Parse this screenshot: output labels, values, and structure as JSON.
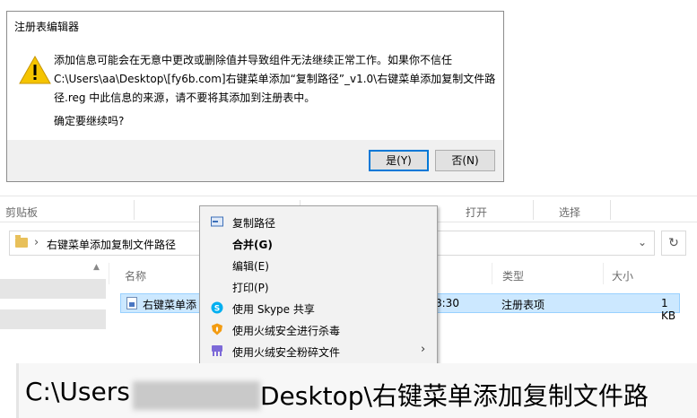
{
  "dialog": {
    "title": "注册表编辑器",
    "message": "添加信息可能会在无意中更改或删除值并导致组件无法继续正常工作。如果你不信任 C:\\Users\\aa\\Desktop\\[fy6b.com]右键菜单添加“复制路径”_v1.0\\右键菜单添加复制文件路径.reg 中此信息的来源，请不要将其添加到注册表中。",
    "confirm": "确定要继续吗?",
    "yes_label": "是(Y)",
    "no_label": "否(N)",
    "icon": "warning-icon"
  },
  "explorer": {
    "ribbon": {
      "clipboard": "剪贴板",
      "open": "打开",
      "select": "选择"
    },
    "address": {
      "separator": "›",
      "path": "右键菜单添加复制文件路径",
      "dropdown": "⌄",
      "refresh": "↻"
    },
    "columns": {
      "name": "名称",
      "type": "类型",
      "size": "大小"
    },
    "file": {
      "name": "右键菜单添",
      "time": "8:30",
      "type": "注册表项",
      "size": "1 KB"
    }
  },
  "context_menu": {
    "items": [
      {
        "label": "复制路径",
        "icon": "copy-path-icon"
      },
      {
        "label": "合并(G)",
        "bold": true
      },
      {
        "label": "编辑(E)"
      },
      {
        "label": "打印(P)"
      },
      {
        "label": "使用 Skype 共享",
        "icon": "skype-icon"
      },
      {
        "label": "使用火绒安全进行杀毒",
        "icon": "huorong-shield-icon"
      },
      {
        "label": "使用火绒安全粉碎文件",
        "icon": "huorong-shred-icon",
        "submenu": "›"
      }
    ]
  },
  "zoom_path": {
    "part1": "C:\\Users",
    "part2": "Desktop\\右键菜单添加复制文件路"
  },
  "colors": {
    "selection": "#cce8ff",
    "focus_border": "#0078d7",
    "warning": "#f5c400"
  }
}
